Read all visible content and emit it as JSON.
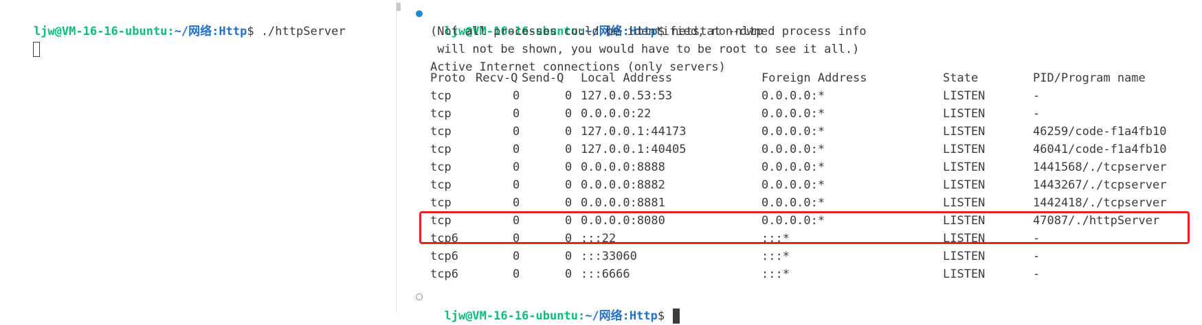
{
  "left_terminal": {
    "prompt_user": "ljw@VM-16-16-ubuntu",
    "prompt_sep": ":",
    "prompt_path": "~/网络:Http",
    "prompt_symbol": "$ ",
    "command": "./httpServer"
  },
  "right_terminal": {
    "prompt_user": "ljw@VM-16-16-ubuntu",
    "prompt_sep": ":",
    "prompt_path": "~/网络:Http",
    "prompt_symbol": "$ ",
    "command": "netstat -nltp",
    "info_lines": [
      "(Not all processes could be identified, non-owned process info",
      " will not be shown, you would have to be root to see it all.)",
      "Active Internet connections (only servers)"
    ],
    "headers": [
      "Proto",
      "Recv-Q",
      "Send-Q",
      "Local Address",
      "Foreign Address",
      "State",
      "PID/Program name"
    ],
    "rows": [
      [
        "tcp",
        "0",
        "0",
        "127.0.0.53:53",
        "0.0.0.0:*",
        "LISTEN",
        "-"
      ],
      [
        "tcp",
        "0",
        "0",
        "0.0.0.0:22",
        "0.0.0.0:*",
        "LISTEN",
        "-"
      ],
      [
        "tcp",
        "0",
        "0",
        "127.0.0.1:44173",
        "0.0.0.0:*",
        "LISTEN",
        "46259/code-f1a4fb10"
      ],
      [
        "tcp",
        "0",
        "0",
        "127.0.0.1:40405",
        "0.0.0.0:*",
        "LISTEN",
        "46041/code-f1a4fb10"
      ],
      [
        "tcp",
        "0",
        "0",
        "0.0.0.0:8888",
        "0.0.0.0:*",
        "LISTEN",
        "1441568/./tcpserver"
      ],
      [
        "tcp",
        "0",
        "0",
        "0.0.0.0:8882",
        "0.0.0.0:*",
        "LISTEN",
        "1443267/./tcpserver"
      ],
      [
        "tcp",
        "0",
        "0",
        "0.0.0.0:8881",
        "0.0.0.0:*",
        "LISTEN",
        "1442418/./tcpserver"
      ],
      [
        "tcp",
        "0",
        "0",
        "0.0.0.0:8080",
        "0.0.0.0:*",
        "LISTEN",
        "47087/./httpServer"
      ],
      [
        "tcp6",
        "0",
        "0",
        ":::22",
        ":::*",
        "LISTEN",
        "-"
      ],
      [
        "tcp6",
        "0",
        "0",
        ":::33060",
        ":::*",
        "LISTEN",
        "-"
      ],
      [
        "tcp6",
        "0",
        "0",
        ":::6666",
        ":::*",
        "LISTEN",
        "-"
      ]
    ],
    "highlighted_row": 7,
    "highlight_color": "#e8231f"
  },
  "colors": {
    "prompt_user": "#0dbc79",
    "prompt_path": "#2472c8",
    "text": "#3b3b3b",
    "background": "#ffffff",
    "status_dot_success": "#1f8ad2"
  }
}
